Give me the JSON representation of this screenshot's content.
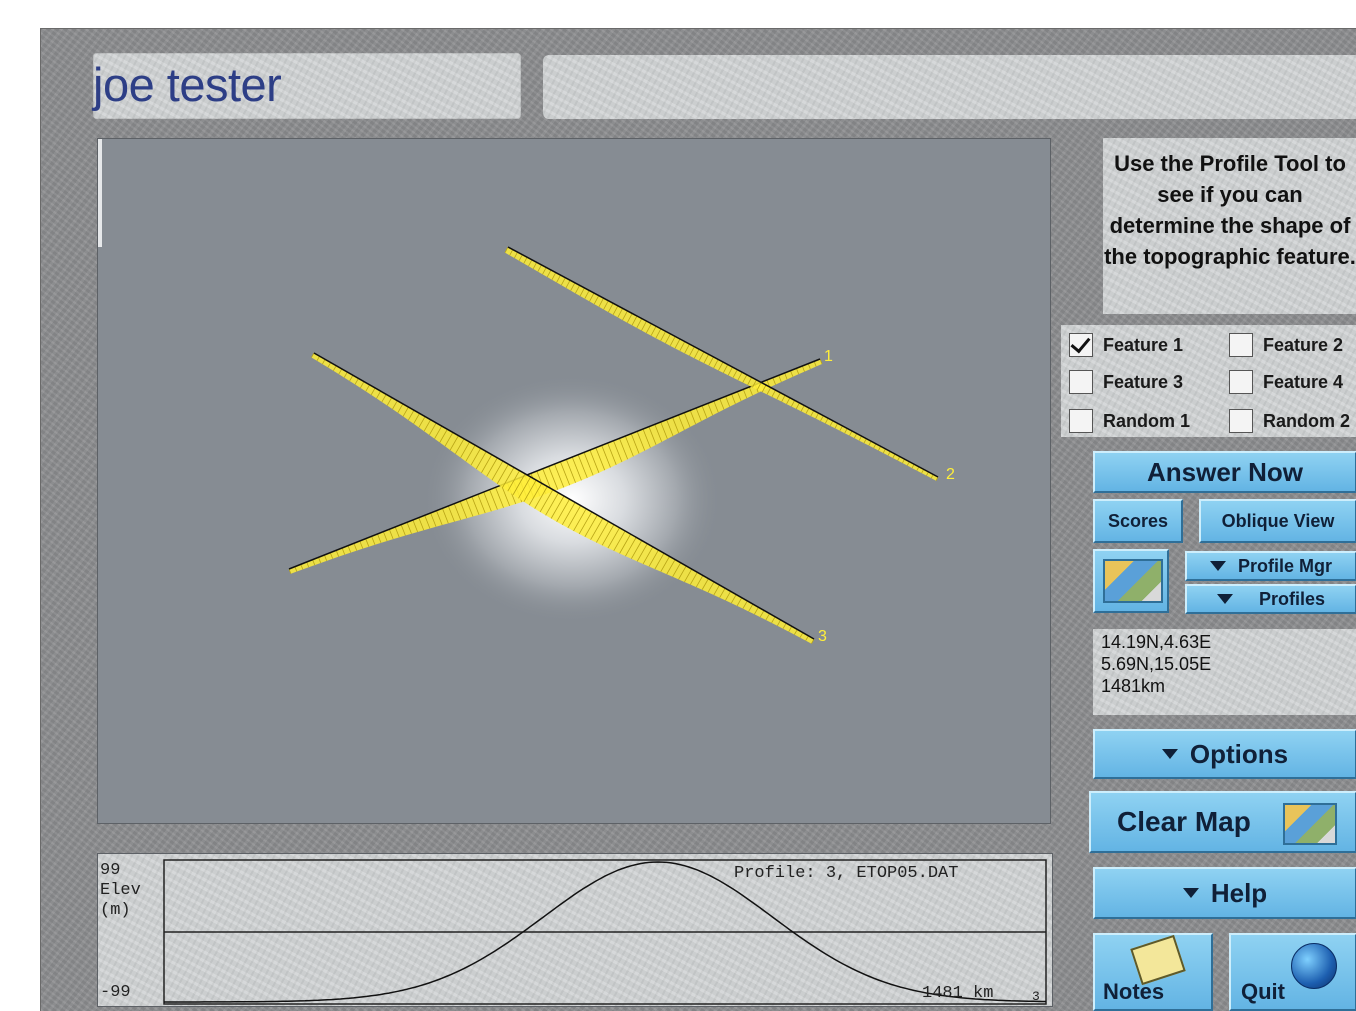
{
  "user": {
    "name": "joe tester"
  },
  "instructions": "Use the Profile Tool to see if you can determine the shape of the topographic feature.",
  "features": [
    {
      "label": "Feature 1",
      "checked": true
    },
    {
      "label": "Feature 2",
      "checked": false
    },
    {
      "label": "Feature 3",
      "checked": false
    },
    {
      "label": "Feature 4",
      "checked": false
    },
    {
      "label": "Random 1",
      "checked": false
    },
    {
      "label": "Random 2",
      "checked": false
    }
  ],
  "buttons": {
    "answer_now": "Answer Now",
    "scores": "Scores",
    "oblique_view": "Oblique View",
    "profile_mgr": "Profile Mgr",
    "profiles": "Profiles",
    "options": "Options",
    "clear_map": "Clear Map",
    "help": "Help",
    "notes": "Notes",
    "quit": "Quit"
  },
  "coords": {
    "line1": "14.19N,4.63E",
    "line2": "5.69N,15.05E",
    "line3": "1481km"
  },
  "map": {
    "profile_labels": [
      "1",
      "2",
      "3"
    ]
  },
  "profile": {
    "ymax": "99",
    "elev_label": "Elev",
    "unit_label": "(m)",
    "ymin": "-99",
    "caption": "Profile: 3, ETOP05.DAT",
    "distance": "1481 km",
    "corner_mark": "3"
  },
  "colors": {
    "profile_line": "#ffef3a",
    "button": "#7cc4ec",
    "title": "#2d3e86"
  }
}
